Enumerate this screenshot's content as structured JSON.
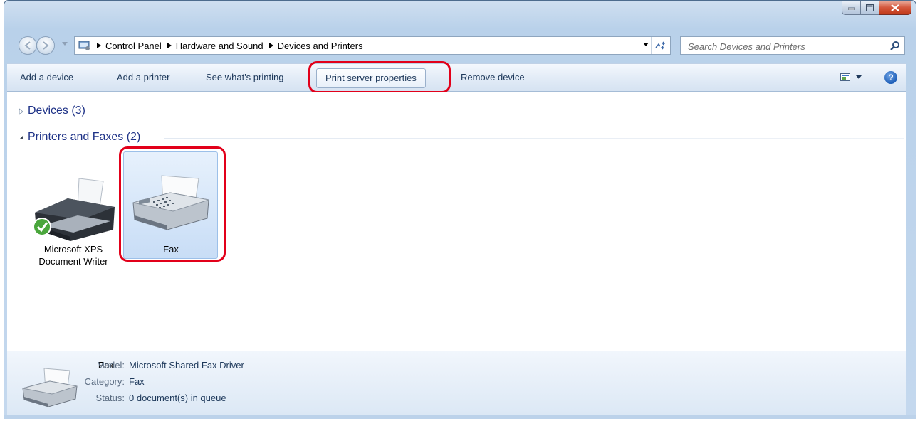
{
  "window": {
    "caption_buttons": {
      "minimize": "minimize-icon",
      "maximize": "maximize-icon",
      "close": "close-icon"
    }
  },
  "address_bar": {
    "crumbs": [
      "Control Panel",
      "Hardware and Sound",
      "Devices and Printers"
    ]
  },
  "search": {
    "placeholder": "Search Devices and Printers"
  },
  "toolbar": {
    "add_device": "Add a device",
    "add_printer": "Add a printer",
    "see_printing": "See what's printing",
    "print_server": "Print server properties",
    "remove_device": "Remove device"
  },
  "groups": {
    "devices": "Devices (3)",
    "printers": "Printers and Faxes (2)"
  },
  "items": [
    {
      "label": "Microsoft XPS Document Writer",
      "default": true
    },
    {
      "label": "Fax",
      "selected": true
    }
  ],
  "details": {
    "name": "Fax",
    "model_key": "Model:",
    "model_val": "Microsoft Shared Fax Driver",
    "category_key": "Category:",
    "category_val": "Fax",
    "status_key": "Status:",
    "status_val": "0 document(s) in queue"
  },
  "colors": {
    "accent_red": "#e2001a",
    "link_blue": "#1e3287"
  }
}
